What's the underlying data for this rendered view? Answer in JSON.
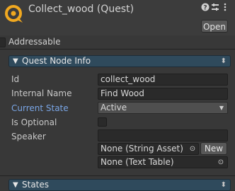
{
  "header": {
    "title": "Collect_wood (Quest)",
    "help_icon": "help-icon",
    "settings_icon": "preset-icon",
    "menu_icon": "kebab-menu-icon",
    "open_label": "Open"
  },
  "addressable": {
    "label": "Addressable",
    "checked": false
  },
  "quest_node_info": {
    "label": "Quest Node Info",
    "expanded": true
  },
  "fields": {
    "id_label": "Id",
    "id_value": "collect_wood",
    "internal_name_label": "Internal Name",
    "internal_name_value": "Find Wood",
    "current_state_label": "Current State",
    "current_state_value": "Active",
    "is_optional_label": "Is Optional",
    "is_optional_checked": false,
    "speaker_label": "Speaker",
    "speaker_string_asset": "None (String Asset)",
    "new_label": "New",
    "speaker_text_table": "None (Text Table)"
  },
  "states": {
    "label": "States",
    "expanded": true
  },
  "colors": {
    "background": "#383838",
    "foldout": "#2f4a5c",
    "accent_label": "#7aa6e6"
  }
}
